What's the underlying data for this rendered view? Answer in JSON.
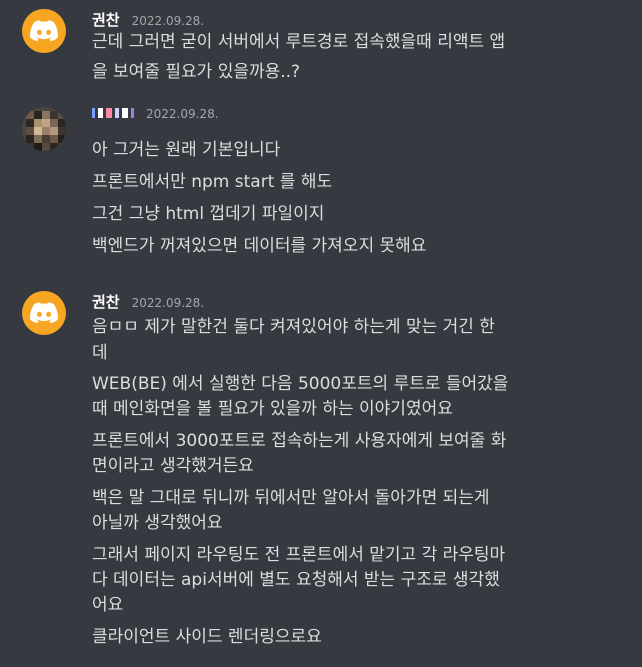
{
  "messages": [
    {
      "username": "권찬",
      "timestamp": "2022.09.28.",
      "avatar_icon": "discord-logo-icon",
      "avatar_color": "#f6a623",
      "lines": [
        "근데 그러면 굳이 서버에서 루트경로 접속했을때 리액트 앱",
        "을 보여줄 필요가 있을까용..?"
      ]
    },
    {
      "username": "",
      "timestamp": "2022.09.28.",
      "avatar_icon": "pixelated-user-avatar-icon",
      "lines": [
        "아 그거는 원래 기본입니다",
        "프론트에서만 npm start 를 해도",
        "그건 그냥 html 껍데기 파일이지",
        "백엔드가 꺼져있으면 데이터를 가져오지 못해요"
      ]
    },
    {
      "username": "권찬",
      "timestamp": "2022.09.28.",
      "avatar_icon": "discord-logo-icon",
      "avatar_color": "#f6a623",
      "lines": [
        "음ㅁㅁ 제가 말한건 둘다 켜져있어야 하는게 맞는 거긴 한",
        "데",
        "WEB(BE) 에서 실행한 다음 5000포트의 루트로 들어갔을",
        "때 메인화면을 볼 필요가 있을까 하는 이야기였어요",
        "프론트에서 3000포트로 접속하는게 사용자에게 보여줄 화",
        "면이라고 생각했거든요",
        "백은 말 그대로 뒤니까 뒤에서만 알아서 돌아가면 되는게",
        "아닐까 생각했어요",
        "그래서 페이지 라우팅도 전 프론트에서 맡기고 각 라우팅마",
        "다 데이터는 api서버에 별도 요청해서 받는 구조로 생각했",
        "어요",
        "클라이언트 사이드 렌더링으로요"
      ]
    }
  ]
}
